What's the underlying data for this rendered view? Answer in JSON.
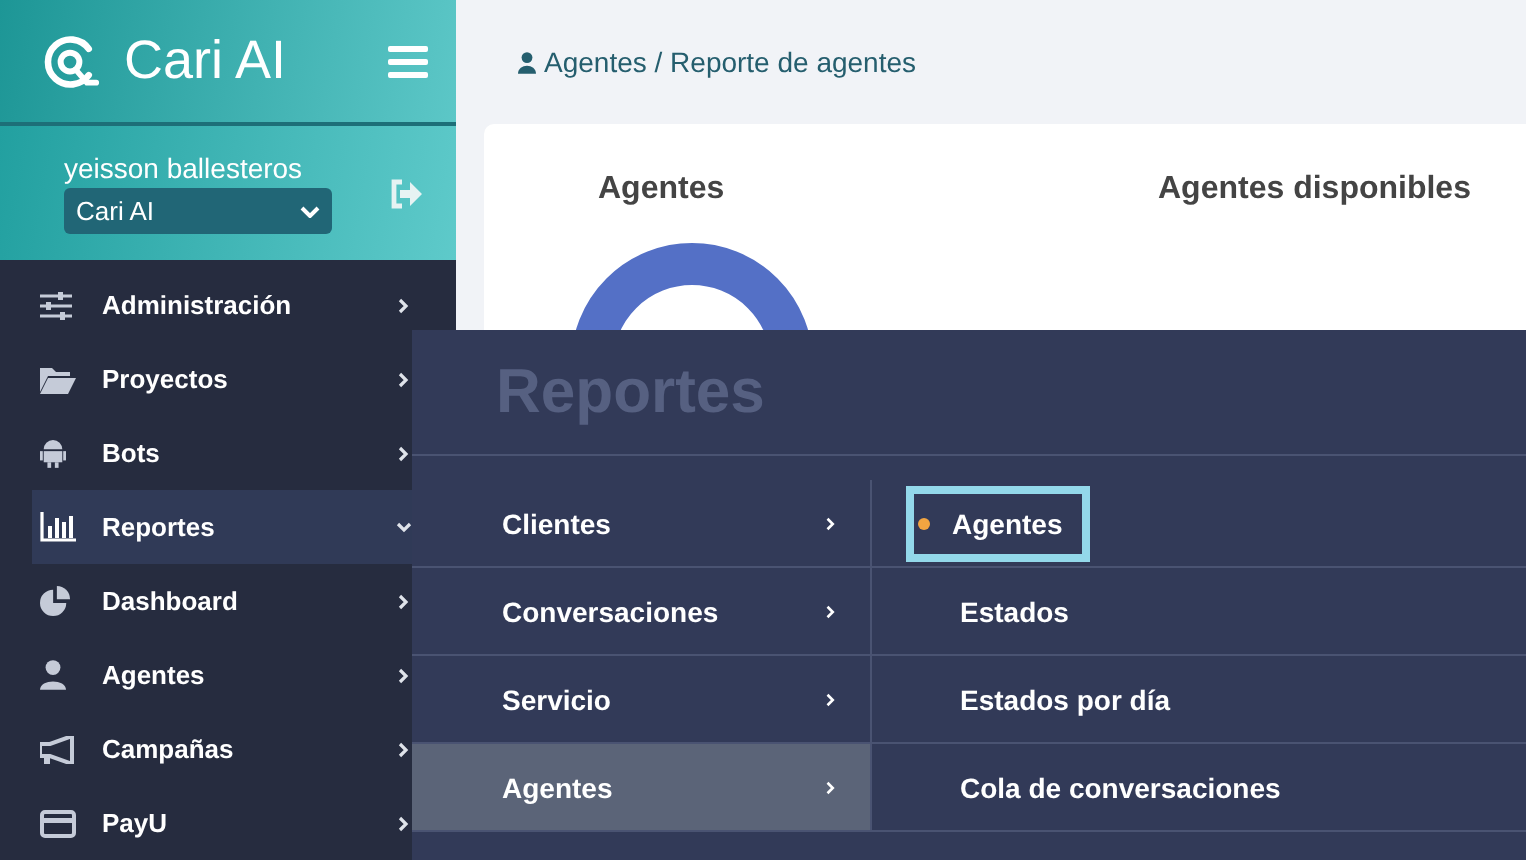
{
  "brand": {
    "name": "Cari AI"
  },
  "user": {
    "name": "yeisson ballesteros",
    "workspace": "Cari AI"
  },
  "nav": [
    {
      "label": "Administración",
      "selected": false
    },
    {
      "label": "Proyectos",
      "selected": false
    },
    {
      "label": "Bots",
      "selected": false
    },
    {
      "label": "Reportes",
      "selected": true
    },
    {
      "label": "Dashboard",
      "selected": false
    },
    {
      "label": "Agentes",
      "selected": false
    },
    {
      "label": "Campañas",
      "selected": false
    },
    {
      "label": "PayU",
      "selected": false
    }
  ],
  "breadcrumb": "Agentes / Reporte de agentes",
  "card": {
    "titles": [
      "Agentes",
      "Agentes disponibles"
    ]
  },
  "flyout": {
    "title": "Reportes",
    "categories": [
      {
        "label": "Clientes",
        "selected": false
      },
      {
        "label": "Conversaciones",
        "selected": false
      },
      {
        "label": "Servicio",
        "selected": false
      },
      {
        "label": "Agentes",
        "selected": true
      }
    ],
    "items": [
      {
        "label": "Agentes",
        "selected": true
      },
      {
        "label": "Estados",
        "selected": false
      },
      {
        "label": "Estados por día",
        "selected": false
      },
      {
        "label": "Cola de conversaciones",
        "selected": false
      }
    ]
  }
}
